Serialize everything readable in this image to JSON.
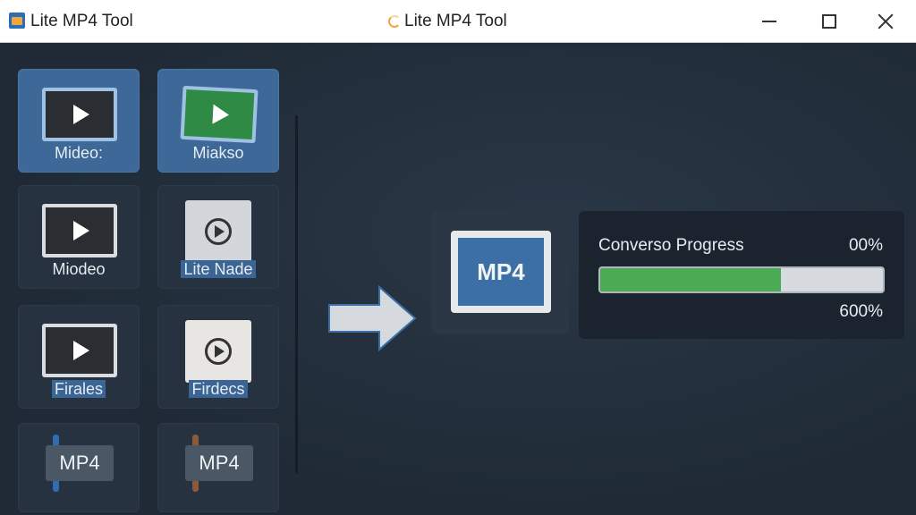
{
  "window": {
    "title_left": "Lite MP4 Tool",
    "title_center": "Lite MP4 Tool"
  },
  "sidebar": {
    "tiles": [
      {
        "label": "Mideo:",
        "icon": "video-screen-icon",
        "active": true
      },
      {
        "label": "Miakso",
        "icon": "green-video-icon",
        "active": true
      },
      {
        "label": "Miodeo",
        "icon": "video-stack-icon",
        "active": false
      },
      {
        "label": "Lite Nade",
        "icon": "video-doc-icon",
        "active": false,
        "highlight": true
      },
      {
        "label": "Firales",
        "icon": "video-stack-icon",
        "active": false,
        "highlight": true
      },
      {
        "label": "Firdecs",
        "icon": "video-file-icon",
        "active": false,
        "highlight": true
      },
      {
        "label": "MP4",
        "icon": "mp4-chip-icon",
        "bar_color": "#2f6db0"
      },
      {
        "label": "MP4",
        "icon": "mp4-chip-icon",
        "bar_color": "#8a5a3a"
      }
    ]
  },
  "output": {
    "format_label": "MP4"
  },
  "progress": {
    "title": "Converso Progress",
    "percent_top": "00%",
    "percent_bottom": "600%",
    "fill_fraction": 0.64,
    "fill_color": "#4caa54"
  },
  "colors": {
    "accent": "#3d6897",
    "background": "#1f2b38"
  }
}
